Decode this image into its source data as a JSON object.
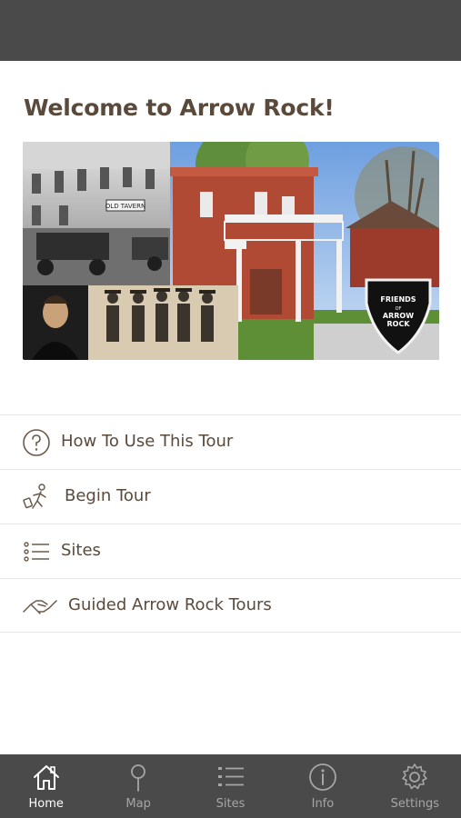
{
  "header": {
    "title": "Welcome to Arrow Rock!"
  },
  "hero": {
    "badge_text": "FRIENDS OF ARROW ROCK",
    "sign_text": "OLD TAVERN"
  },
  "menu": [
    {
      "label": "How To Use This Tour",
      "icon": "question-circle-icon"
    },
    {
      "label": "Begin Tour",
      "icon": "walking-person-icon"
    },
    {
      "label": "Sites",
      "icon": "list-icon"
    },
    {
      "label": "Guided Arrow Rock Tours",
      "icon": "handshake-icon"
    }
  ],
  "tabs": [
    {
      "label": "Home",
      "icon": "home-icon",
      "active": true
    },
    {
      "label": "Map",
      "icon": "map-pin-icon",
      "active": false
    },
    {
      "label": "Sites",
      "icon": "list-icon",
      "active": false
    },
    {
      "label": "Info",
      "icon": "info-icon",
      "active": false
    },
    {
      "label": "Settings",
      "icon": "gear-icon",
      "active": false
    }
  ],
  "colors": {
    "brand_text": "#5a4a3b",
    "bar": "#4a4a4a",
    "tab_inactive": "#a6a6a6",
    "divider": "#e6e6e6"
  }
}
